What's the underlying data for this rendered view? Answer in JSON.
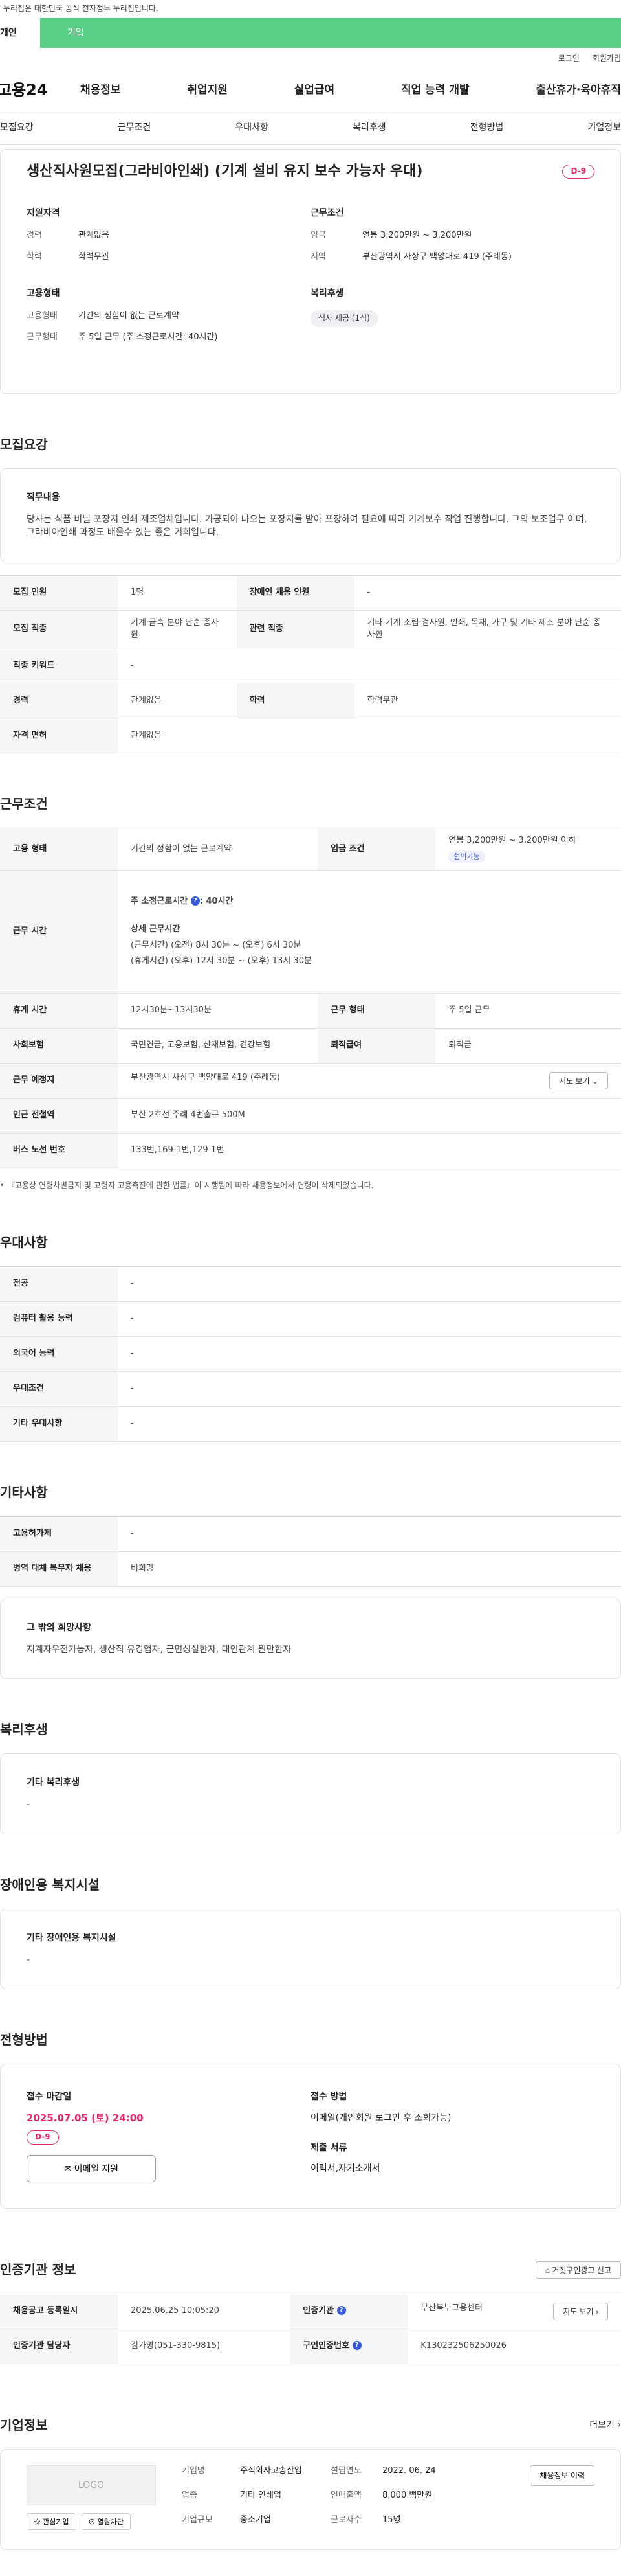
{
  "gov_banner": "이 누리집은 대한민국 공식 전자정부 누리집입니다.",
  "tabs": {
    "personal": "개인",
    "company": "기업"
  },
  "util": {
    "login": "로그인",
    "join": "회원가입"
  },
  "logo": "고용24",
  "gnb": [
    "채용정보",
    "취업지원",
    "실업급여",
    "직업 능력 개발",
    "출산휴가·육아휴직"
  ],
  "anchors": [
    "모집요강",
    "근무조건",
    "우대사항",
    "복리후생",
    "전형방법",
    "기업정보"
  ],
  "header": {
    "title": "생산직사원모집(그라비아인쇄) (기계 설비 유지 보수 가능자 우대)",
    "dday": "D-9",
    "qual_title": "지원자격",
    "qual": [
      {
        "k": "경력",
        "v": "관계없음"
      },
      {
        "k": "학력",
        "v": "학력무관"
      }
    ],
    "emp_title": "고용형태",
    "emp": [
      {
        "k": "고용형태",
        "v": "기간의 정함이 없는 근로계약"
      },
      {
        "k": "근무형태",
        "v": "주 5일 근무 (주 소정근로시간: 40시간)"
      }
    ],
    "cond_title": "근무조건",
    "cond": [
      {
        "k": "임금",
        "v": "연봉 3,200만원 ~ 3,200만원"
      },
      {
        "k": "지역",
        "v": "부산광역시 사상구 백양대로 419 (주례동)"
      }
    ],
    "welfare_title": "복리후생",
    "welfare_chip": "식사 제공 (1식)"
  },
  "recruit": {
    "section_title": "모집요강",
    "duty_title": "직무내용",
    "duty_text": "당사는 식품 비닐 포장지 인쇄 제조업체입니다. 가공되어 나오는 포장지를 받아 포장하여 필요에 따라 기계보수 작업 진행합니다. 그외 보조업무 이며, 그라비아인쇄 과정도 배울수 있는 좋은 기회입니다.",
    "rows": [
      {
        "k1": "모집 인원",
        "v1": "1명",
        "k2": "장애인 채용 인원",
        "v2": "-"
      },
      {
        "k1": "모집 직종",
        "v1": "기계·금속 분야 단순 종사원",
        "k2": "관련 직종",
        "v2": "기타 기계 조립·검사원, 인쇄, 목재, 가구 및 기타 제조 분야 단순 종사원"
      }
    ],
    "keyword_k": "직종 키워드",
    "keyword_v": "-",
    "row3": {
      "k1": "경력",
      "v1": "관계없음",
      "k2": "학력",
      "v2": "학력무관"
    },
    "license_k": "자격 면허",
    "license_v": "관계없음"
  },
  "work": {
    "section_title": "근무조건",
    "emp_k": "고용 형태",
    "emp_v": "기간의 정함이 없는 근로계약",
    "wage_k": "임금 조건",
    "wage_v": "연봉 3,200만원 ~ 3,200만원 이하",
    "wage_badge": "협의가능",
    "hours_k": "근무 시간",
    "hours_main": "주 소정근로시간",
    "hours_value": ": 40시간",
    "hours_detail_title": "상세 근무시간",
    "hours_line1": "(근무시간) (오전) 8시 30분 ~ (오후) 6시 30분",
    "hours_line2": "(휴게시간) (오후) 12시 30분 ~ (오후) 13시 30분",
    "rest_k": "휴게 시간",
    "rest_v": "12시30분~13시30분",
    "type_k": "근무 형태",
    "type_v": "주 5일 근무",
    "ins_k": "사회보험",
    "ins_v": "국민연금, 고용보험, 산재보험, 건강보험",
    "ret_k": "퇴직급여",
    "ret_v": "퇴직금",
    "place_k": "근무 예정지",
    "place_v": "부산광역시 사상구 백양대로 419 (주례동)",
    "map_btn": "지도 보기",
    "subway_k": "인근 전철역",
    "subway_v": "부산 2호선 주례 4번출구 500M",
    "bus_k": "버스 노선 번호",
    "bus_v": "133번,169-1번,129-1번",
    "note": "『고용상 연령차별금지 및 고령자 고용촉진에 관한 법률』이 시행됨에 따라 채용정보에서 연령이 삭제되었습니다."
  },
  "pref": {
    "section_title": "우대사항",
    "rows": [
      {
        "k": "전공",
        "v": "-"
      },
      {
        "k": "컴퓨터 활용 능력",
        "v": "-"
      },
      {
        "k": "외국어 능력",
        "v": "-"
      },
      {
        "k": "우대조건",
        "v": "-"
      },
      {
        "k": "기타 우대사항",
        "v": "-"
      }
    ]
  },
  "etc": {
    "section_title": "기타사항",
    "rows": [
      {
        "k": "고용허가제",
        "v": "-"
      },
      {
        "k": "병역 대체 복무자 채용",
        "v": "비희망"
      }
    ],
    "hope_title": "그 밖의 희망사항",
    "hope_text": "저계자우전가능자, 생산직 유경험자, 근면성실한자, 대인관계 원만한자"
  },
  "welfare": {
    "section_title": "복리후생",
    "box_title": "기타 복리후생",
    "box_text": "-"
  },
  "disability": {
    "section_title": "장애인용 복지시설",
    "box_title": "기타 장애인용 복지시설",
    "box_text": "-"
  },
  "apply": {
    "section_title": "전형방법",
    "deadline_title": "접수 마감일",
    "deadline": "2025.07.05 (토) 24:00",
    "dday": "D-9",
    "email_btn": "이메일 지원",
    "method_title": "접수 방법",
    "method": "이메일(개인회원 로그인 후 조회가능)",
    "docs_title": "제출 서류",
    "docs": "이력서,자기소개서"
  },
  "cert": {
    "section_title": "인증기관 정보",
    "fake_btn": "거짓구인광고 신고",
    "reg_k": "채용공고 등록일시",
    "reg_v": "2025.06.25 10:05:20",
    "org_k": "인증기관",
    "org_v": "부산북부고용센터",
    "map_btn": "지도 보기",
    "mgr_k": "인증기관 담당자",
    "mgr_v": "김가영(051-330-9815)",
    "no_k": "구인인증번호",
    "no_v": "K130232506250026"
  },
  "company": {
    "section_title": "기업정보",
    "more": "더보기",
    "logo_text": "LOGO",
    "interest_btn": "관심기업",
    "block_btn": "열람차단",
    "name_k": "기업명",
    "name_v": "주식회사고송산업",
    "est_k": "설립연도",
    "est_v": "2022. 06. 24",
    "ind_k": "업종",
    "ind_v": "기타 인쇄업",
    "sales_k": "연매출액",
    "sales_v": "8,000 백만원",
    "size_k": "기업규모",
    "size_v": "중소기업",
    "emp_k": "근로자수",
    "emp_v": "15명",
    "history_btn": "채용정보 이력"
  }
}
